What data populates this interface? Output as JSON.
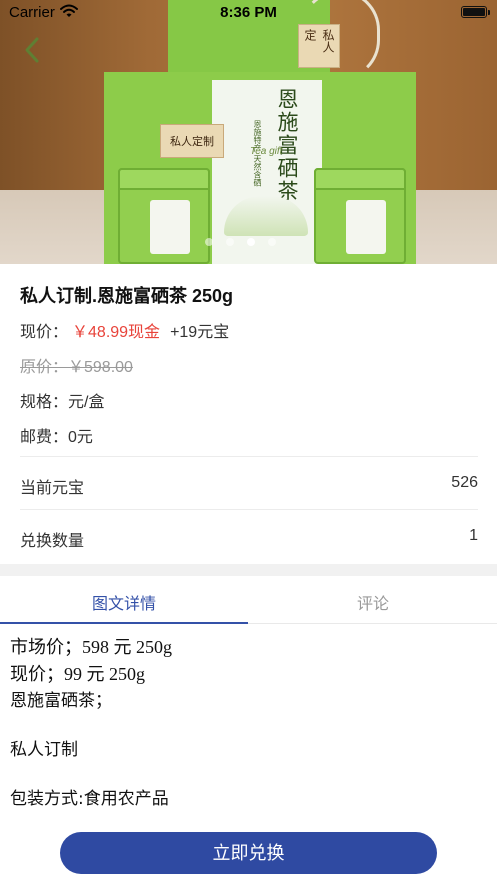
{
  "status_bar": {
    "carrier": "Carrier",
    "time": "8:36 PM",
    "battery_level": 1.0
  },
  "hero": {
    "slide_count": 4,
    "active_slide_index": 2,
    "bag_tag_text": "私人定",
    "box_label_text": "私人定制",
    "box_title_text": "恩施富硒茶",
    "box_subtitle_text": "恩施特产 天然含硒",
    "box_english_text": "Tea gift"
  },
  "product": {
    "title": "私人订制.恩施富硒茶 250g",
    "price_label": "现价：",
    "price_cash": "￥48.99现金",
    "price_extra": "+19元宝",
    "original_price_text": "原价：￥598.00",
    "spec_label": "规格：",
    "spec_value": "元/盒",
    "shipping_label": "邮费：",
    "shipping_value": "0元"
  },
  "redeem": {
    "balance_label": "当前元宝",
    "balance_value": "526",
    "quantity_label": "兑换数量",
    "quantity_value": "1"
  },
  "tabs": {
    "detail": "图文详情",
    "reviews": "评论",
    "active": "detail"
  },
  "detail_content": {
    "line1": "市场价；598 元 250g",
    "line2": "现价；99 元 250g",
    "line3": "恩施富硒茶；",
    "line4": "私人订制",
    "line5": "包装方式:食用农产品"
  },
  "cta": {
    "label": "立即兑换"
  },
  "colors": {
    "accent_blue": "#2f4aa2",
    "price_red": "#e8433a",
    "muted_gray": "#999999"
  }
}
